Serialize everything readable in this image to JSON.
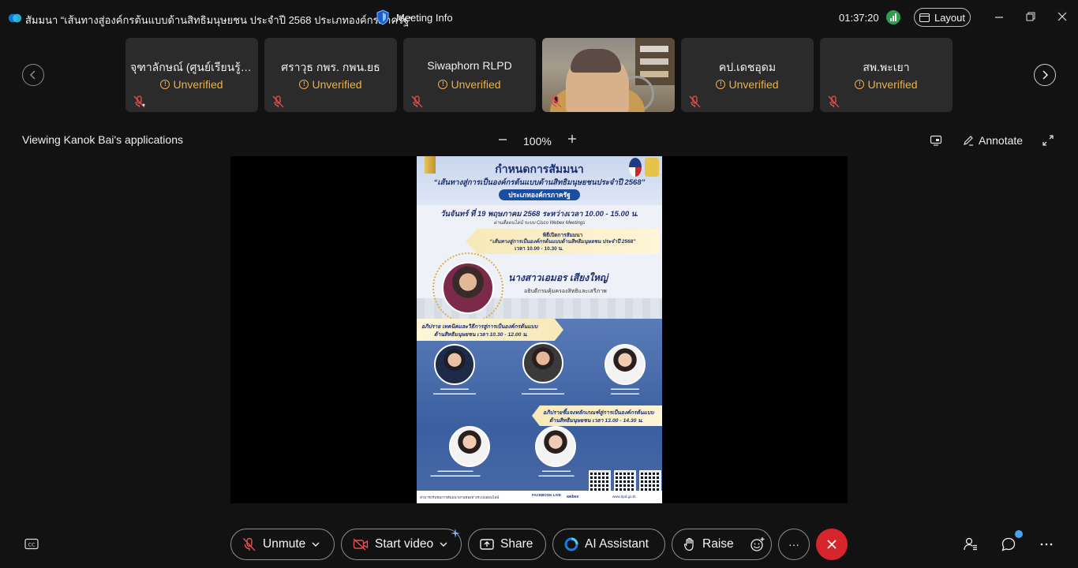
{
  "window": {
    "title": "สัมมนา “เส้นทางสู่องค์กรต้นแบบด้านสิทธิมนุษยชน ประจำปี 2568 ประเภทองค์กรภาครัฐ”",
    "meeting_info": "Meeting Info",
    "timer": "01:37:20",
    "layout_label": "Layout"
  },
  "participants": [
    {
      "name": "จุฑาลักษณ์ (ศูนย์เรียนรู้ฯ...",
      "status": "Unverified"
    },
    {
      "name": "ศราวุธ กพร. กพน.ยธ",
      "status": "Unverified"
    },
    {
      "name": "Siwaphorn RLPD",
      "status": "Unverified"
    },
    {
      "name": "",
      "status": ""
    },
    {
      "name": "คป.เดชอุดม",
      "status": "Unverified"
    },
    {
      "name": "สพ.พะเยา",
      "status": "Unverified"
    }
  ],
  "share": {
    "viewing_label": "Viewing Kanok Bai's applications",
    "zoom": "100%",
    "annotate_label": "Annotate"
  },
  "poster": {
    "title": "กำหนดการสัมมนา",
    "subtitle": "“เส้นทางสู่การเป็นองค์กรต้นแบบด้านสิทธิมนุษยชนประจำปี 2568”",
    "category": "ประเภทองค์กรภาครัฐ",
    "date": "วันจันทร์ ที่ 19 พฤษภาคม 2568 ระหว่างเวลา 10.00 - 15.00 น.",
    "via": "ผ่านสื่ออนไลน์ ระบบ Cisco Webex Meetings",
    "opening_a": "พิธีเปิดการสัมมนา",
    "opening_b": "“เส้นทางสู่การเป็นองค์กรต้นแบบด้านสิทธิมนุษยชน ประจำปี 2568”",
    "opening_time": "เวลา 10.00 - 10.30 น.",
    "chief_name": "นางสาวเอมอร  เสียงใหญ่",
    "chief_role": "อธิบดีกรมคุ้มครองสิทธิและเสรีภาพ",
    "session1_a": "อภิปราย เทคนิคและวิธีการสู่การเป็นองค์กรต้นแบบ",
    "session1_b": "ด้านสิทธิมนุษยชน เวลา 10.30 - 12.00 น.",
    "session2_a": "อภิปรายชี้แจงหลักเกณฑ์สู่การเป็นองค์กรต้นแบบ",
    "session2_b": "ด้านสิทธิมนุษยชน เวลา 13.00 - 14.30 น.",
    "footer_text": "สามารถรับชมการสัมมนาผ่านช่องทางระบบออนไลน์",
    "footer_fb": "FACEBOOK LIVE",
    "footer_webex": "webex",
    "footer_web": "www.rlpd.go.th"
  },
  "controls": {
    "unmute": "Unmute",
    "start_video": "Start video",
    "share": "Share",
    "ai_assistant": "AI Assistant",
    "raise": "Raise",
    "more": "···"
  },
  "colors": {
    "unverified": "#f0b13a",
    "end_call": "#d6262c",
    "signal": "#2e9e4f"
  }
}
